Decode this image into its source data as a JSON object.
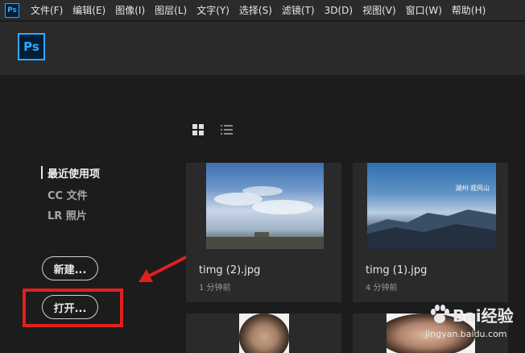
{
  "app": {
    "mini_logo": "Ps",
    "logo": "Ps"
  },
  "menu": [
    "文件(F)",
    "编辑(E)",
    "图像(I)",
    "图层(L)",
    "文字(Y)",
    "选择(S)",
    "滤镜(T)",
    "3D(D)",
    "视图(V)",
    "窗口(W)",
    "帮助(H)"
  ],
  "view_toggle": {
    "grid_icon": "grid-view-icon",
    "list_icon": "list-view-icon",
    "active": "grid"
  },
  "nav": [
    {
      "label": "最近使用项",
      "active": true
    },
    {
      "label": "CC 文件",
      "active": false
    },
    {
      "label": "LR 照片",
      "active": false
    }
  ],
  "buttons": {
    "new": "新建...",
    "open": "打开..."
  },
  "recent_files": [
    {
      "name": "timg (2).jpg",
      "time": "1 分钟前",
      "thumb_overlay": ""
    },
    {
      "name": "timg (1).jpg",
      "time": "4 分钟前",
      "thumb_overlay": "湖州·观风山"
    },
    {
      "name": "",
      "time": "",
      "thumb_overlay": ""
    },
    {
      "name": "",
      "time": "",
      "thumb_overlay": ""
    }
  ],
  "annotation_color": "#e02020",
  "accent_color": "#31a8ff",
  "watermark": {
    "brand": "Bai",
    "brand2": "经验",
    "url": "jingyan.baidu.com"
  }
}
